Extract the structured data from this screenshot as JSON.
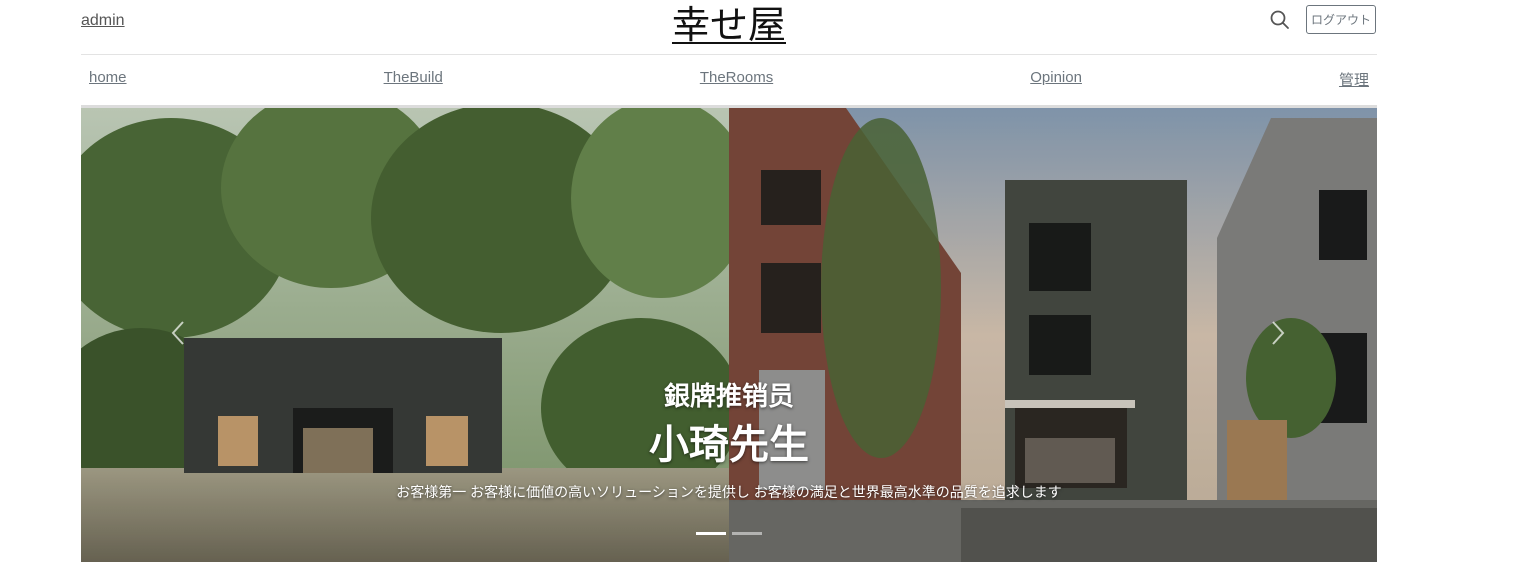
{
  "header": {
    "user_label": "admin",
    "site_title": "幸せ屋",
    "search_icon": "search-icon",
    "logout_label": "ログアウト"
  },
  "nav": {
    "items": [
      {
        "label": "home"
      },
      {
        "label": "TheBuild"
      },
      {
        "label": "TheRooms"
      },
      {
        "label": "Opinion"
      },
      {
        "label": "管理"
      }
    ]
  },
  "carousel": {
    "prev_icon": "chevron-left-icon",
    "next_icon": "chevron-right-icon",
    "subtitle": "銀牌推销员",
    "title": "小琦先生",
    "text": "お客様第一 お客様に価値の高いソリューションを提供し お客様の満足と世界最高水準の品質を追求します",
    "active_slide": 1,
    "slide_count": 2
  },
  "colors": {
    "link": "#6c757d",
    "title": "#111111",
    "divider": "#e3e3e3"
  }
}
